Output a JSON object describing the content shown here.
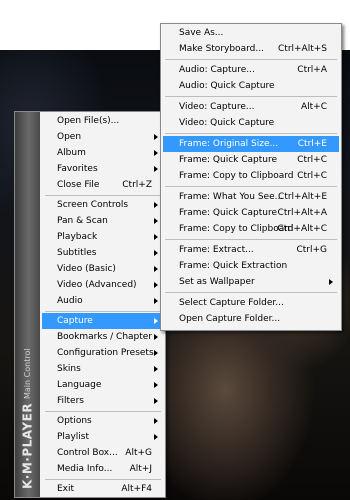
{
  "brand": {
    "name": "K·M·PLAYER",
    "subtitle": "Main Control"
  },
  "main_menu": {
    "open_files": "Open File(s)...",
    "open": "Open",
    "album": "Album",
    "favorites": "Favorites",
    "close_file": {
      "label": "Close File",
      "shortcut": "Ctrl+Z"
    },
    "screen_controls": "Screen Controls",
    "pan_scan": "Pan & Scan",
    "playback": "Playback",
    "subtitles": "Subtitles",
    "video_basic": "Video (Basic)",
    "video_advanced": "Video (Advanced)",
    "audio": "Audio",
    "capture": "Capture",
    "bookmarks": "Bookmarks / Chapter",
    "config_presets": "Configuration Presets",
    "skins": "Skins",
    "language": "Language",
    "filters": "Filters",
    "options": "Options",
    "playlist": "Playlist",
    "control_box": {
      "label": "Control Box...",
      "shortcut": "Alt+G"
    },
    "media_info": {
      "label": "Media Info...",
      "shortcut": "Alt+J"
    },
    "exit": {
      "label": "Exit",
      "shortcut": "Alt+F4"
    }
  },
  "capture_menu": {
    "save_as": {
      "label": "Save As...",
      "shortcut": ""
    },
    "make_storyboard": {
      "label": "Make Storyboard...",
      "shortcut": "Ctrl+Alt+S"
    },
    "audio_capture": {
      "label": "Audio: Capture...",
      "shortcut": "Ctrl+A"
    },
    "audio_quick": {
      "label": "Audio: Quick Capture",
      "shortcut": ""
    },
    "video_capture": {
      "label": "Video: Capture...",
      "shortcut": "Alt+C"
    },
    "video_quick": {
      "label": "Video: Quick Capture",
      "shortcut": ""
    },
    "frame_original": {
      "label": "Frame: Original Size...",
      "shortcut": "Ctrl+E"
    },
    "frame_quick": {
      "label": "Frame: Quick Capture",
      "shortcut": "Ctrl+C"
    },
    "frame_clipboard": {
      "label": "Frame: Copy to Clipboard",
      "shortcut": "Ctrl+C"
    },
    "frame_what_see": {
      "label": "Frame: What You See...",
      "shortcut": "Ctrl+Alt+E"
    },
    "frame_quick2": {
      "label": "Frame: Quick Capture",
      "shortcut": "Ctrl+Alt+A"
    },
    "frame_clipboard2": {
      "label": "Frame: Copy to Clipboard",
      "shortcut": "Ctrl+Alt+C"
    },
    "frame_extract": {
      "label": "Frame: Extract...",
      "shortcut": "Ctrl+G"
    },
    "frame_quick_extract": {
      "label": "Frame: Quick Extraction",
      "shortcut": ""
    },
    "set_wallpaper": {
      "label": "Set as Wallpaper",
      "shortcut": ""
    },
    "select_folder": {
      "label": "Select Capture Folder...",
      "shortcut": ""
    },
    "open_folder": {
      "label": "Open Capture Folder...",
      "shortcut": ""
    }
  }
}
